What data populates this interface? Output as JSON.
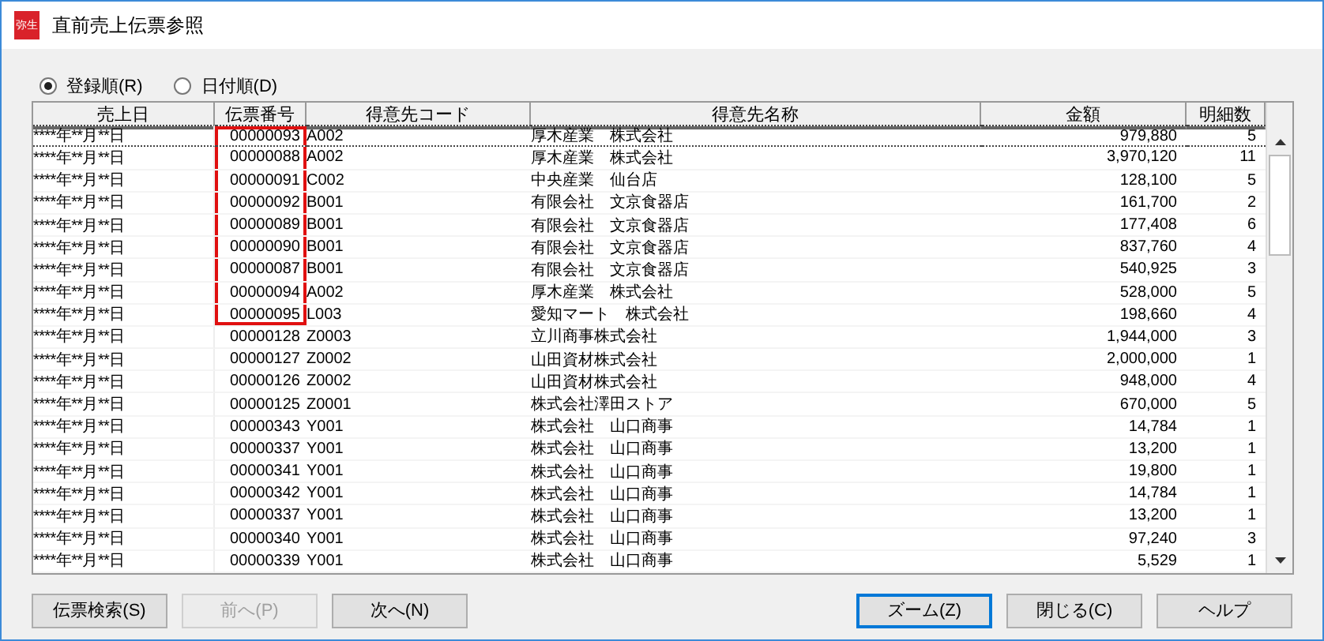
{
  "window": {
    "title": "直前売上伝票参照",
    "app_badge": "弥生"
  },
  "sort_options": [
    {
      "label": "登録順(R)",
      "selected": true
    },
    {
      "label": "日付順(D)",
      "selected": false
    }
  ],
  "table": {
    "columns": [
      "売上日",
      "伝票番号",
      "得意先コード",
      "得意先名称",
      "金額",
      "明細数"
    ],
    "rows": [
      {
        "date": "****年**月**日",
        "slip": "00000093",
        "code": "A002",
        "name": "厚木産業　株式会社",
        "amount": "979,880",
        "lines": "5",
        "selected": true,
        "highlighted": true
      },
      {
        "date": "****年**月**日",
        "slip": "00000088",
        "code": "A002",
        "name": "厚木産業　株式会社",
        "amount": "3,970,120",
        "lines": "11",
        "selected": false,
        "highlighted": true
      },
      {
        "date": "****年**月**日",
        "slip": "00000091",
        "code": "C002",
        "name": "中央産業　仙台店",
        "amount": "128,100",
        "lines": "5",
        "selected": false,
        "highlighted": true
      },
      {
        "date": "****年**月**日",
        "slip": "00000092",
        "code": "B001",
        "name": "有限会社　文京食器店",
        "amount": "161,700",
        "lines": "2",
        "selected": false,
        "highlighted": true
      },
      {
        "date": "****年**月**日",
        "slip": "00000089",
        "code": "B001",
        "name": "有限会社　文京食器店",
        "amount": "177,408",
        "lines": "6",
        "selected": false,
        "highlighted": true
      },
      {
        "date": "****年**月**日",
        "slip": "00000090",
        "code": "B001",
        "name": "有限会社　文京食器店",
        "amount": "837,760",
        "lines": "4",
        "selected": false,
        "highlighted": true
      },
      {
        "date": "****年**月**日",
        "slip": "00000087",
        "code": "B001",
        "name": "有限会社　文京食器店",
        "amount": "540,925",
        "lines": "3",
        "selected": false,
        "highlighted": true
      },
      {
        "date": "****年**月**日",
        "slip": "00000094",
        "code": "A002",
        "name": "厚木産業　株式会社",
        "amount": "528,000",
        "lines": "5",
        "selected": false,
        "highlighted": true
      },
      {
        "date": "****年**月**日",
        "slip": "00000095",
        "code": "L003",
        "name": "愛知マート　株式会社",
        "amount": "198,660",
        "lines": "4",
        "selected": false,
        "highlighted": true
      },
      {
        "date": "****年**月**日",
        "slip": "00000128",
        "code": "Z0003",
        "name": "立川商事株式会社",
        "amount": "1,944,000",
        "lines": "3",
        "selected": false,
        "highlighted": false
      },
      {
        "date": "****年**月**日",
        "slip": "00000127",
        "code": "Z0002",
        "name": "山田資材株式会社",
        "amount": "2,000,000",
        "lines": "1",
        "selected": false,
        "highlighted": false
      },
      {
        "date": "****年**月**日",
        "slip": "00000126",
        "code": "Z0002",
        "name": "山田資材株式会社",
        "amount": "948,000",
        "lines": "4",
        "selected": false,
        "highlighted": false
      },
      {
        "date": "****年**月**日",
        "slip": "00000125",
        "code": "Z0001",
        "name": "株式会社澤田ストア",
        "amount": "670,000",
        "lines": "5",
        "selected": false,
        "highlighted": false
      },
      {
        "date": "****年**月**日",
        "slip": "00000343",
        "code": "Y001",
        "name": "株式会社　山口商事",
        "amount": "14,784",
        "lines": "1",
        "selected": false,
        "highlighted": false
      },
      {
        "date": "****年**月**日",
        "slip": "00000337",
        "code": "Y001",
        "name": "株式会社　山口商事",
        "amount": "13,200",
        "lines": "1",
        "selected": false,
        "highlighted": false
      },
      {
        "date": "****年**月**日",
        "slip": "00000341",
        "code": "Y001",
        "name": "株式会社　山口商事",
        "amount": "19,800",
        "lines": "1",
        "selected": false,
        "highlighted": false
      },
      {
        "date": "****年**月**日",
        "slip": "00000342",
        "code": "Y001",
        "name": "株式会社　山口商事",
        "amount": "14,784",
        "lines": "1",
        "selected": false,
        "highlighted": false
      },
      {
        "date": "****年**月**日",
        "slip": "00000337",
        "code": "Y001",
        "name": "株式会社　山口商事",
        "amount": "13,200",
        "lines": "1",
        "selected": false,
        "highlighted": false
      },
      {
        "date": "****年**月**日",
        "slip": "00000340",
        "code": "Y001",
        "name": "株式会社　山口商事",
        "amount": "97,240",
        "lines": "3",
        "selected": false,
        "highlighted": false
      },
      {
        "date": "****年**月**日",
        "slip": "00000339",
        "code": "Y001",
        "name": "株式会社　山口商事",
        "amount": "5,529",
        "lines": "1",
        "selected": false,
        "highlighted": false
      }
    ]
  },
  "buttons_left": [
    {
      "label": "伝票検索(S)",
      "disabled": false
    },
    {
      "label": "前へ(P)",
      "disabled": true
    },
    {
      "label": "次へ(N)",
      "disabled": false
    }
  ],
  "buttons_right": [
    {
      "label": "ズーム(Z)",
      "disabled": false,
      "default": true
    },
    {
      "label": "閉じる(C)",
      "disabled": false,
      "default": false
    },
    {
      "label": "ヘルプ",
      "disabled": false,
      "default": false
    }
  ]
}
